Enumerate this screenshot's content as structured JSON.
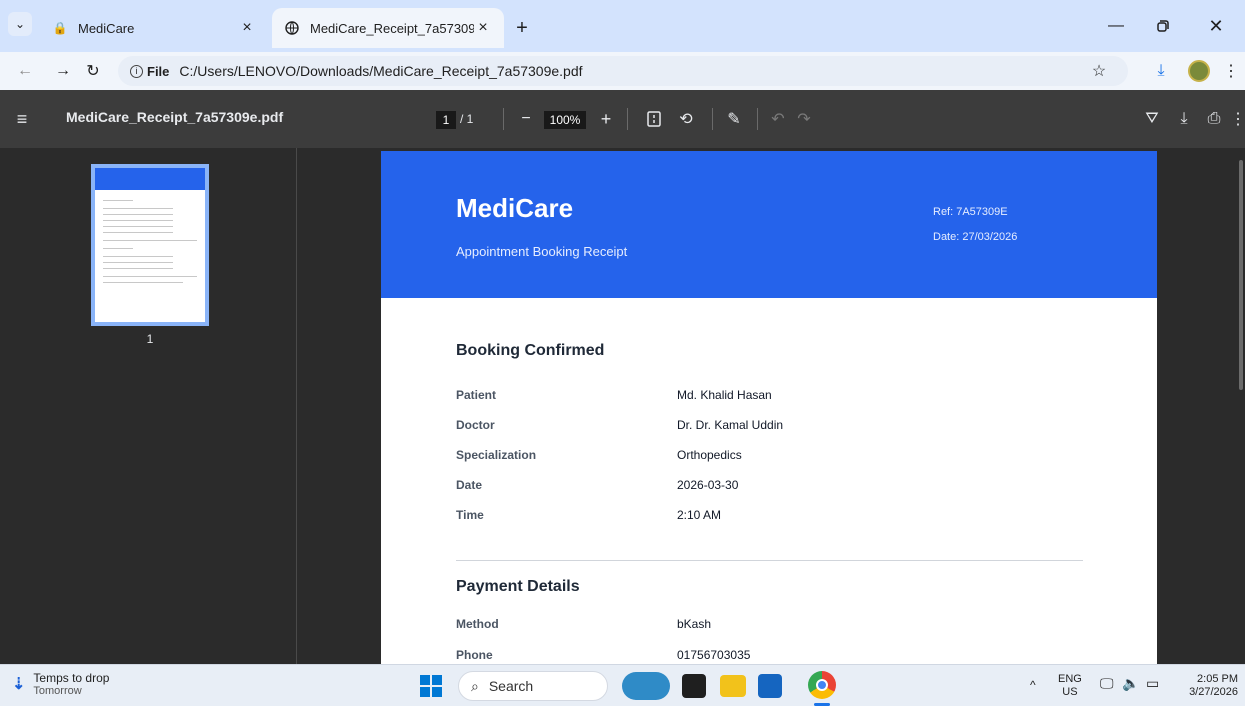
{
  "browser": {
    "tabs": [
      {
        "title": "MediCare",
        "active": false
      },
      {
        "title": "MediCare_Receipt_7a57309e.pdf",
        "active": true
      }
    ],
    "new_tab": "+",
    "address": {
      "chip": "File",
      "url": "C:/Users/LENOVO/Downloads/MediCare_Receipt_7a57309e.pdf"
    }
  },
  "pdf_toolbar": {
    "filename": "MediCare_Receipt_7a57309e.pdf",
    "page_current": "1",
    "page_total": "/ 1",
    "zoom": "100%"
  },
  "sidebar": {
    "thumbnail_label": "1"
  },
  "receipt": {
    "brand": "MediCare",
    "subtitle": "Appointment Booking Receipt",
    "ref": "Ref: 7A57309E",
    "date": "Date: 27/03/2026",
    "booking": {
      "heading": "Booking Confirmed",
      "rows": [
        {
          "label": "Patient",
          "value": "Md. Khalid Hasan"
        },
        {
          "label": "Doctor",
          "value": "Dr. Dr. Kamal Uddin"
        },
        {
          "label": "Specialization",
          "value": "Orthopedics"
        },
        {
          "label": "Date",
          "value": "2026-03-30"
        },
        {
          "label": "Time",
          "value": "2:10 AM"
        }
      ]
    },
    "payment": {
      "heading": "Payment Details",
      "rows": [
        {
          "label": "Method",
          "value": "bKash"
        },
        {
          "label": "Phone",
          "value": "01756703035"
        }
      ]
    }
  },
  "taskbar": {
    "weather_title": "Temps to drop",
    "weather_sub": "Tomorrow",
    "search_label": "Search",
    "lang_top": "ENG",
    "lang_bottom": "US",
    "time": "2:05 PM",
    "date": "3/27/2026"
  },
  "colors": {
    "brand_blue": "#2563eb",
    "tab_strip": "#d3e3fd",
    "pdf_toolbar": "#3c3c3c"
  }
}
